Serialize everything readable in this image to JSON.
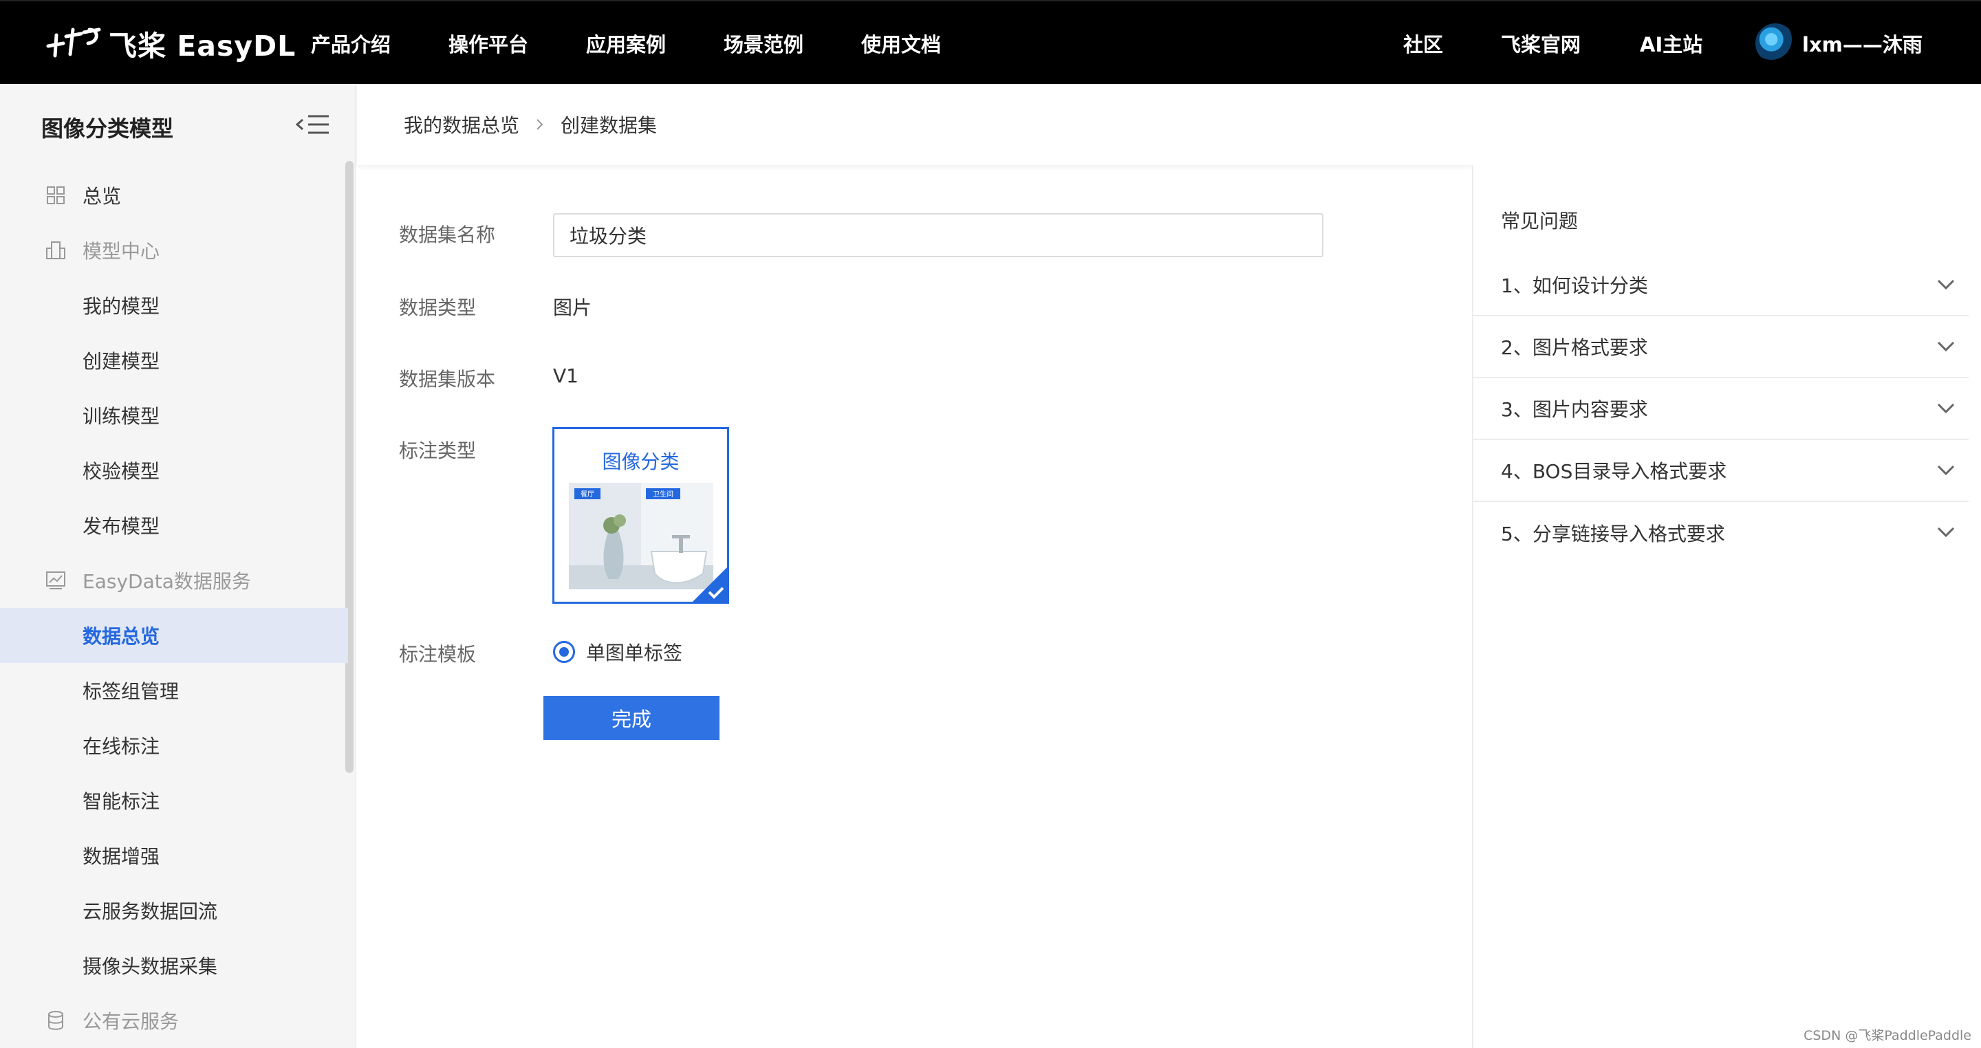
{
  "topnav": {
    "logo_text": "飞桨 EasyDL",
    "links": [
      "产品介绍",
      "操作平台",
      "应用案例",
      "场景范例",
      "使用文档"
    ],
    "right_links": [
      "社区",
      "飞桨官网",
      "AI主站"
    ],
    "username": "lxm——沐雨"
  },
  "sidebar": {
    "title": "图像分类模型",
    "overview": "总览",
    "model_center": "模型中心",
    "model_items": [
      "我的模型",
      "创建模型",
      "训练模型",
      "校验模型",
      "发布模型"
    ],
    "easydata": "EasyData数据服务",
    "data_items": [
      "数据总览",
      "标签组管理",
      "在线标注",
      "智能标注",
      "数据增强",
      "云服务数据回流",
      "摄像头数据采集"
    ],
    "public_cloud": "公有云服务"
  },
  "breadcrumb": {
    "parent": "我的数据总览",
    "current": "创建数据集"
  },
  "form": {
    "name_label": "数据集名称",
    "name_value": "垃圾分类",
    "type_label": "数据类型",
    "type_value": "图片",
    "version_label": "数据集版本",
    "version_value": "V1",
    "anno_type_label": "标注类型",
    "anno_type_option": "图像分类",
    "anno_img_tags": [
      "餐厅",
      "卫生间"
    ],
    "template_label": "标注模板",
    "template_option": "单图单标签",
    "submit_label": "完成"
  },
  "faq": {
    "title": "常见问题",
    "items": [
      "1、如何设计分类",
      "2、图片格式要求",
      "3、图片内容要求",
      "4、BOS目录导入格式要求",
      "5、分享链接导入格式要求"
    ]
  },
  "watermark": "CSDN @飞桨PaddlePaddle",
  "colors": {
    "accent": "#2468e0",
    "topbar": "#000000",
    "sidebar_bg": "#f5f5f5",
    "active_bg": "#e1e7f4"
  }
}
